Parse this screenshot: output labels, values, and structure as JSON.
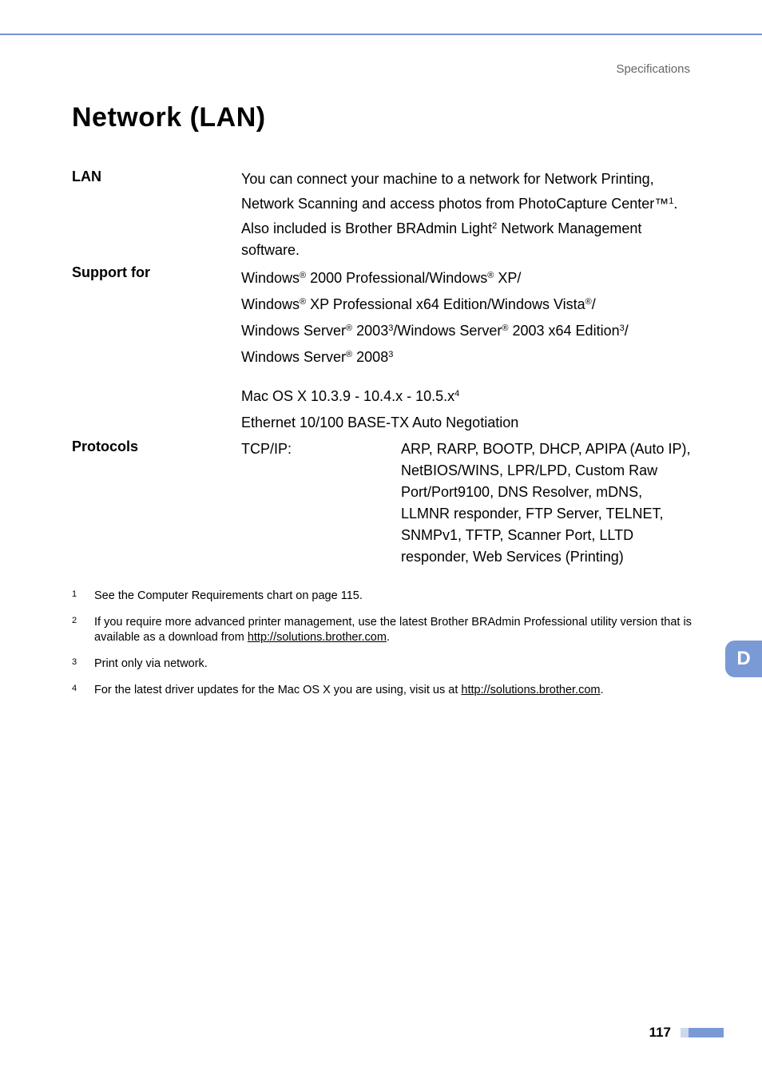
{
  "header": {
    "section": "Specifications"
  },
  "title": "Network (LAN)",
  "specs": {
    "lan_label": "LAN",
    "lan_text_1a": "You can connect your machine to a network for Network Printing, Network Scanning and access photos from PhotoCapture Center™",
    "lan_text_1b": ". Also included is Brother BRAdmin Light",
    "lan_text_1c": " Network Management software.",
    "support_label": "Support for",
    "support_win_a": "Windows",
    "support_win_b": " 2000 Professional/Windows",
    "support_win_c": " XP/",
    "support_win2_a": "Windows",
    "support_win2_b": " XP Professional x64 Edition/Windows Vista",
    "support_win2_c": "/",
    "support_win3_a": "Windows Server",
    "support_win3_b": " 2003",
    "support_win3_c": "/Windows Server",
    "support_win3_d": " 2003 x64 Edition",
    "support_win3_e": "/",
    "support_win4_a": "Windows Server",
    "support_win4_b": " 2008",
    "support_mac": "Mac OS X 10.3.9 - 10.4.x - 10.5.x",
    "support_eth": "Ethernet 10/100 BASE-TX Auto Negotiation",
    "protocols_label": "Protocols",
    "proto_left": "TCP/IP:",
    "proto_right": "ARP, RARP, BOOTP, DHCP, APIPA (Auto IP), NetBIOS/WINS, LPR/LPD, Custom Raw Port/Port9100, DNS Resolver, mDNS, LLMNR responder, FTP Server, TELNET, SNMPv1, TFTP, Scanner Port, LLTD responder, Web Services (Printing)"
  },
  "sup": {
    "s1": "1",
    "s2": "2",
    "s3": "3",
    "s4": "4",
    "reg": "®"
  },
  "footnotes": {
    "n1": "1",
    "t1": "See the Computer Requirements chart on page 115.",
    "n2": "2",
    "t2a": "If you require more advanced printer management, use the latest Brother BRAdmin Professional utility version that is available as a download from ",
    "t2b": "http://solutions.brother.com",
    "t2c": ".",
    "n3": "3",
    "t3": "Print only via network.",
    "n4": "4",
    "t4a": "For the latest driver updates for the Mac OS X you are using, visit us at ",
    "t4b": "http://solutions.brother.com",
    "t4c": "."
  },
  "side_tab": "D",
  "page_number": "117"
}
